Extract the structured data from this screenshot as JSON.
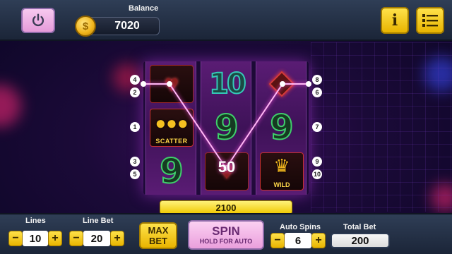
{
  "header": {
    "balance_label": "Balance",
    "balance_value": "7020",
    "coin_symbol": "$",
    "info_label": "i"
  },
  "reels": [
    [
      "heart",
      "scatter",
      "nine"
    ],
    [
      "ten",
      "nine",
      "heart"
    ],
    [
      "diamond",
      "nine",
      "wild"
    ]
  ],
  "symbol_labels": {
    "scatter": "SCATTER",
    "wild": "WILD"
  },
  "win": {
    "symbol_amount": "50",
    "total": "2100"
  },
  "line_markers": {
    "left": [
      "4",
      "2",
      "1",
      "3",
      "5"
    ],
    "right": [
      "8",
      "6",
      "7",
      "9",
      "10"
    ]
  },
  "controls": {
    "lines_label": "Lines",
    "lines_value": "10",
    "line_bet_label": "Line Bet",
    "line_bet_value": "20",
    "max_bet_line1": "MAX",
    "max_bet_line2": "BET",
    "spin_label": "SPIN",
    "spin_sub": "HOLD FOR AUTO",
    "auto_spins_label": "Auto Spins",
    "auto_spins_value": "6",
    "total_bet_label": "Total Bet",
    "total_bet_value": "200",
    "minus": "−",
    "plus": "+"
  },
  "colors": {
    "accent_yellow": "#f0c800",
    "spin_pink": "#ea9fdc",
    "payline": "#ff9bf0"
  }
}
